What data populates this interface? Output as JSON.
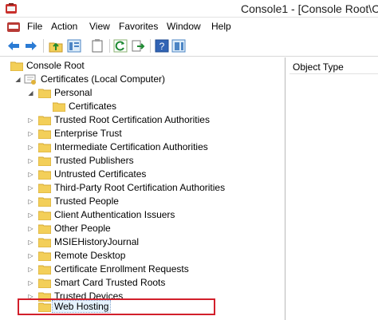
{
  "window": {
    "title": "Console1 - [Console Root\\C"
  },
  "menu": {
    "items": [
      "File",
      "Action",
      "View",
      "Favorites",
      "Window",
      "Help"
    ]
  },
  "toolbar": {
    "buttons": [
      "back-icon",
      "forward-icon",
      "up-folder-icon",
      "show-hide-tree-icon",
      "properties-icon",
      "refresh-icon",
      "export-list-icon",
      "help-icon",
      "show-hide-action-pane-icon"
    ]
  },
  "tree": {
    "root": "Console Root",
    "certificates": "Certificates (Local Computer)",
    "personal": "Personal",
    "personal_certificates": "Certificates",
    "items": [
      "Trusted Root Certification Authorities",
      "Enterprise Trust",
      "Intermediate Certification Authorities",
      "Trusted Publishers",
      "Untrusted Certificates",
      "Third-Party Root Certification Authorities",
      "Trusted People",
      "Client Authentication Issuers",
      "Other People",
      "MSIEHistoryJournal",
      "Remote Desktop",
      "Certificate Enrollment Requests",
      "Smart Card Trusted Roots",
      "Trusted Devices"
    ],
    "selected": "Web Hosting"
  },
  "details": {
    "column_header": "Object Type"
  },
  "colors": {
    "folder": "#f3cf59",
    "folder_edge": "#d4a933",
    "highlight": "#d21f2b",
    "selection": "#e5f3ff"
  }
}
